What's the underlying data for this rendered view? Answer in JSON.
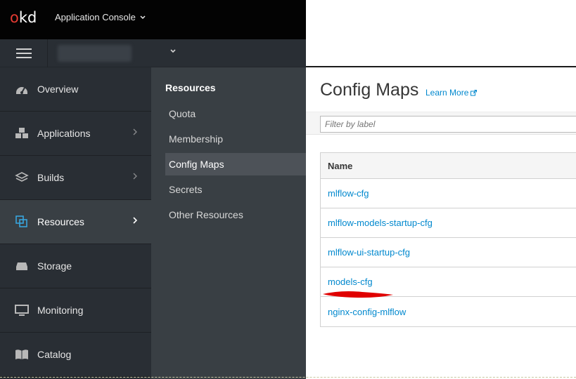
{
  "header": {
    "logo_prefix": "o",
    "logo_suffix": "kd",
    "app_switcher": "Application Console"
  },
  "sidebar": {
    "items": [
      {
        "label": "Overview",
        "icon": "dashboard-icon",
        "has_chevron": false
      },
      {
        "label": "Applications",
        "icon": "cubes-icon",
        "has_chevron": true
      },
      {
        "label": "Builds",
        "icon": "layers-icon",
        "has_chevron": true
      },
      {
        "label": "Resources",
        "icon": "resources-icon",
        "has_chevron": true,
        "active": true
      },
      {
        "label": "Storage",
        "icon": "storage-icon",
        "has_chevron": false
      },
      {
        "label": "Monitoring",
        "icon": "monitor-icon",
        "has_chevron": false
      },
      {
        "label": "Catalog",
        "icon": "book-icon",
        "has_chevron": false
      }
    ]
  },
  "subnav": {
    "title": "Resources",
    "items": [
      {
        "label": "Quota"
      },
      {
        "label": "Membership"
      },
      {
        "label": "Config Maps",
        "active": true
      },
      {
        "label": "Secrets"
      },
      {
        "label": "Other Resources"
      }
    ]
  },
  "main": {
    "title": "Config Maps",
    "learn_more": "Learn More",
    "filter_placeholder": "Filter by label",
    "table": {
      "header": "Name",
      "rows": [
        "mlflow-cfg",
        "mlflow-models-startup-cfg",
        "mlflow-ui-startup-cfg",
        "models-cfg",
        "nginx-config-mlflow"
      ]
    }
  },
  "colors": {
    "link": "#0088ce",
    "sidebar_bg": "#292e34",
    "active_bg": "#393f44",
    "accent": "#39a5dc",
    "logo_red": "#e53b32"
  }
}
